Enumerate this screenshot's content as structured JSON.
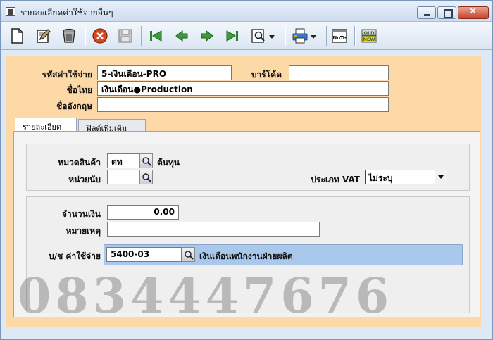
{
  "window": {
    "title": "รายละเอียดค่าใช้จ่ายอื่นๆ"
  },
  "toolbar": {
    "items": [
      {
        "name": "new",
        "icon": "new-document-icon"
      },
      {
        "name": "edit",
        "icon": "edit-icon"
      },
      {
        "name": "delete",
        "icon": "trash-icon"
      },
      {
        "name": "cancel",
        "icon": "cancel-icon"
      },
      {
        "name": "save",
        "icon": "save-icon"
      },
      {
        "name": "first",
        "icon": "first-record-icon"
      },
      {
        "name": "previous",
        "icon": "arrow-left-icon"
      },
      {
        "name": "next",
        "icon": "arrow-right-icon"
      },
      {
        "name": "last",
        "icon": "last-record-icon"
      },
      {
        "name": "search",
        "icon": "search-icon"
      },
      {
        "name": "print",
        "icon": "printer-icon"
      },
      {
        "name": "note",
        "icon": "note-icon",
        "label": "NoTe"
      },
      {
        "name": "old-new",
        "icon": "old-new-icon",
        "label_top": "OLD",
        "label_bottom": "NEW"
      }
    ]
  },
  "header": {
    "expense_code_label": "รหัสค่าใช้จ่าย",
    "expense_code_value": "5-เงินเดือน-PRO",
    "barcode_label": "บาร์โค้ด",
    "barcode_value": "",
    "thai_name_label": "ชื่อไทย",
    "thai_name_value": "เงินเดือน●Production",
    "english_name_label": "ชื่ออังกฤษ",
    "english_name_value": ""
  },
  "tabs": [
    {
      "label": "รายละเอียด",
      "active": true
    },
    {
      "label": "ฟิลด์เพิ่มเติม",
      "active": false
    }
  ],
  "details": {
    "category_label": "หมวดสินค้า",
    "category_value": "ตท",
    "category_desc": "ต้นทุน",
    "unit_label": "หน่วยนับ",
    "unit_value": "",
    "vat_label": "ประเภท VAT",
    "vat_value": "ไม่ระบุ",
    "amount_label": "จำนวนเงิน",
    "amount_value": "0.00",
    "note_label": "หมายเหตุ",
    "note_value": "",
    "account_label": "บ/ช ค่าใช้จ่าย",
    "account_value": "5400-03",
    "account_desc": "เงินเดือนพนักงานฝ่ายผลิต"
  },
  "watermark": {
    "text": "0834447676"
  },
  "colors": {
    "form_background": "#fcd9a6",
    "account_highlight": "#a9c8ec",
    "window_frame": "#dfe9f5"
  }
}
